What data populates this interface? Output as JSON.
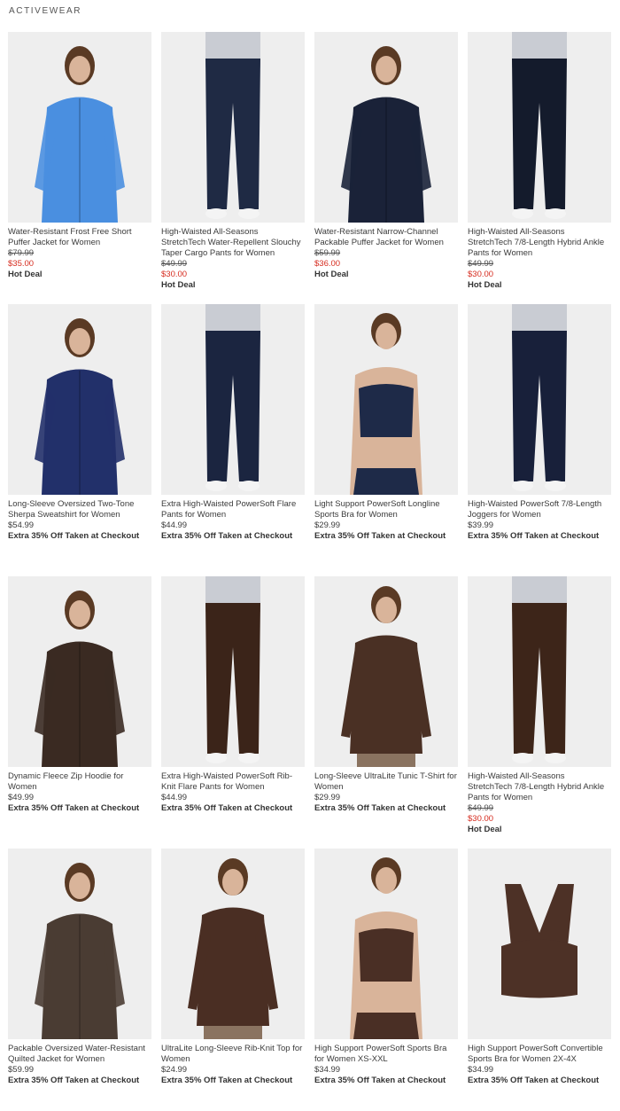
{
  "section_title": "ACTIVEWEAR",
  "products": [
    {
      "name": "Water-Resistant Frost Free Short Puffer Jacket for Women",
      "original_price": "$79.99",
      "sale_price": "$35.00",
      "price": "",
      "promo": "Hot Deal",
      "garment_color": "#4a8fe0",
      "figure": "jacket"
    },
    {
      "name": "High-Waisted All-Seasons StretchTech Water-Repellent Slouchy Taper Cargo Pants for Women",
      "original_price": "$49.99",
      "sale_price": "$30.00",
      "price": "",
      "promo": "Hot Deal",
      "garment_color": "#1f2a44",
      "figure": "pants"
    },
    {
      "name": "Water-Resistant Narrow-Channel Packable Puffer Jacket for Women",
      "original_price": "$59.99",
      "sale_price": "$36.00",
      "price": "",
      "promo": "Hot Deal",
      "garment_color": "#1a2238",
      "figure": "jacket"
    },
    {
      "name": "High-Waisted All-Seasons StretchTech 7/8-Length Hybrid Ankle Pants for Women",
      "original_price": "$49.99",
      "sale_price": "$30.00",
      "price": "",
      "promo": "Hot Deal",
      "garment_color": "#141b2c",
      "figure": "pants"
    },
    {
      "name": "Long-Sleeve Oversized Two-Tone Sherpa Sweatshirt for Women",
      "original_price": "",
      "sale_price": "",
      "price": "$54.99",
      "promo": "Extra 35% Off Taken at Checkout",
      "garment_color": "#22306a",
      "figure": "jacket"
    },
    {
      "name": "Extra High-Waisted PowerSoft Flare Pants for Women",
      "original_price": "",
      "sale_price": "",
      "price": "$44.99",
      "promo": "Extra 35% Off Taken at Checkout",
      "garment_color": "#1b2540",
      "figure": "pants"
    },
    {
      "name": "Light Support PowerSoft Longline Sports Bra for Women",
      "original_price": "",
      "sale_price": "",
      "price": "$29.99",
      "promo": "Extra 35% Off Taken at Checkout",
      "garment_color": "#1e2a48",
      "figure": "bra"
    },
    {
      "name": "High-Waisted PowerSoft 7/8-Length Joggers for Women",
      "original_price": "",
      "sale_price": "",
      "price": "$39.99",
      "promo": "Extra 35% Off Taken at Checkout",
      "garment_color": "#18203a",
      "figure": "pants"
    },
    {
      "name": "Dynamic Fleece Zip Hoodie for Women",
      "original_price": "",
      "sale_price": "",
      "price": "$49.99",
      "promo": "Extra 35% Off Taken at Checkout",
      "garment_color": "#3a2a22",
      "figure": "jacket"
    },
    {
      "name": "Extra High-Waisted PowerSoft Rib-Knit Flare Pants for Women",
      "original_price": "",
      "sale_price": "",
      "price": "$44.99",
      "promo": "Extra 35% Off Taken at Checkout",
      "garment_color": "#3b2419",
      "figure": "pants"
    },
    {
      "name": "Long-Sleeve UltraLite Tunic T-Shirt for Women",
      "original_price": "",
      "sale_price": "",
      "price": "$29.99",
      "promo": "Extra 35% Off Taken at Checkout",
      "garment_color": "#4a3024",
      "figure": "top"
    },
    {
      "name": "High-Waisted All-Seasons StretchTech 7/8-Length Hybrid Ankle Pants for Women",
      "original_price": "$49.99",
      "sale_price": "$30.00",
      "price": "",
      "promo": "Hot Deal",
      "garment_color": "#3d2519",
      "figure": "pants"
    },
    {
      "name": "Packable Oversized Water-Resistant Quilted Jacket for Women",
      "original_price": "",
      "sale_price": "",
      "price": "$59.99",
      "promo": "Extra 35% Off Taken at Checkout",
      "garment_color": "#4a3c33",
      "figure": "jacket"
    },
    {
      "name": "UltraLite Long-Sleeve Rib-Knit Top for Women",
      "original_price": "",
      "sale_price": "",
      "price": "$24.99",
      "promo": "Extra 35% Off Taken at Checkout",
      "garment_color": "#4a2e23",
      "figure": "top"
    },
    {
      "name": "High Support PowerSoft Sports Bra for Women XS-XXL",
      "original_price": "",
      "sale_price": "",
      "price": "$34.99",
      "promo": "Extra 35% Off Taken at Checkout",
      "garment_color": "#4a2f25",
      "figure": "bra"
    },
    {
      "name": "High Support PowerSoft Convertible Sports Bra for Women 2X-4X",
      "original_price": "",
      "sale_price": "",
      "price": "$34.99",
      "promo": "Extra 35% Off Taken at Checkout",
      "garment_color": "#4d3126",
      "figure": "flatbra"
    }
  ]
}
